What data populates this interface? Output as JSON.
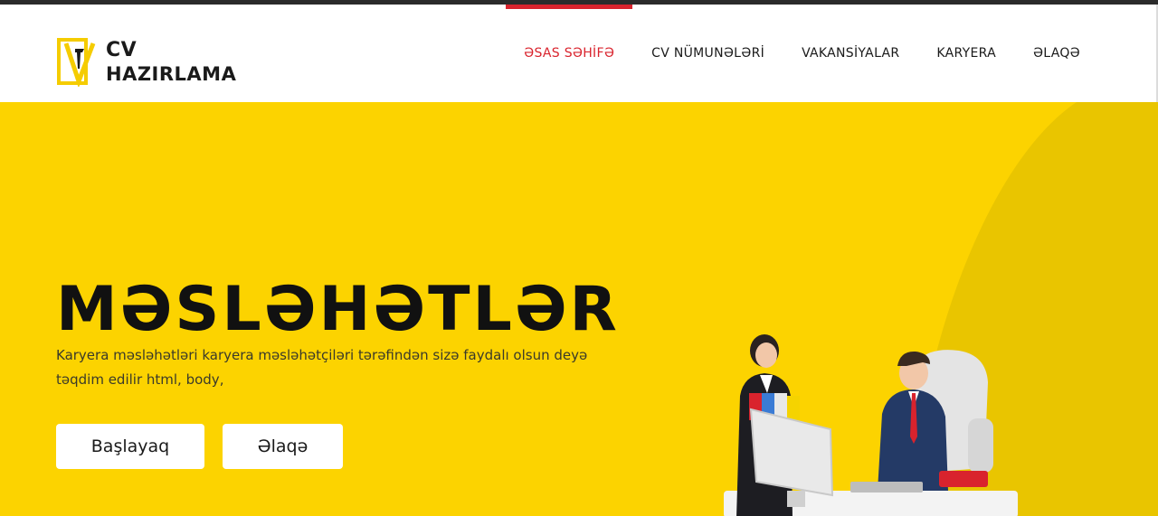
{
  "logo": {
    "line1": "CV",
    "line2": "HAZIRLAMA"
  },
  "nav": {
    "items": [
      {
        "label": "ƏSAS SƏHİFƏ",
        "active": true
      },
      {
        "label": "CV NÜMUNƏLƏRİ",
        "active": false
      },
      {
        "label": "VAKANSİYALAR",
        "active": false
      },
      {
        "label": "KARYERA",
        "active": false
      },
      {
        "label": "ƏLAQƏ",
        "active": false
      }
    ]
  },
  "hero": {
    "title": "MƏSLƏHƏTLƏR",
    "subtitle": "Karyera məsləhətləri karyera məsləhətçiləri tərəfindən sizə faydalı olsun deyə təqdim edilir html, body,",
    "buttons": {
      "start": "Başlayaq",
      "contact": "Əlaqə"
    }
  },
  "colors": {
    "accent": "#d9232d",
    "hero_bg": "#fcd300",
    "hero_curve": "#e9c500",
    "logo_yellow": "#f5cc00"
  }
}
